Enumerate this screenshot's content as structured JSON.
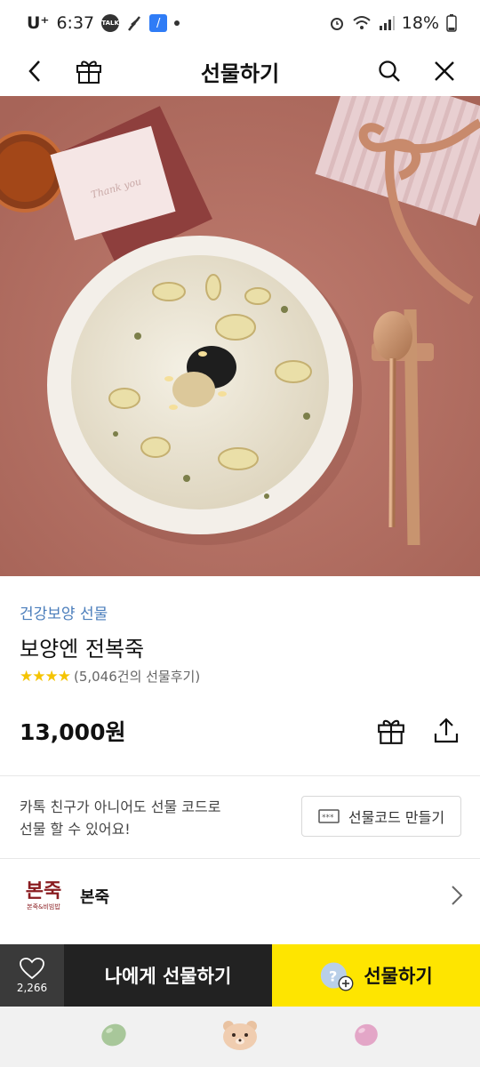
{
  "status_bar": {
    "carrier": "U⁺",
    "time": "6:37",
    "talk_badge": "TALK",
    "battery": "18%"
  },
  "header": {
    "title": "선물하기",
    "back_icon": "chevron-left-icon",
    "gift_icon": "gift-icon",
    "search_icon": "search-icon",
    "close_icon": "close-icon"
  },
  "hero": {
    "card_text": "Thank you",
    "colors": {
      "background": "#b87468",
      "bowl": "#f3efe9",
      "porridge": "#e9e3d3"
    }
  },
  "product": {
    "category": "건강보양 선물",
    "name": "보양엔 전복죽",
    "stars": "★★★★",
    "rating_value": 4,
    "review_text": "(5,046건의 선물후기)",
    "price": "13,000원"
  },
  "gift_code": {
    "description_line1": "카톡 친구가 아니어도 선물 코드로",
    "description_line2": "선물 할 수 있어요!",
    "button_label": "선물코드 만들기"
  },
  "brand": {
    "logo_main": "본죽",
    "logo_sub": "본죽&비빔밥",
    "name": "본죽"
  },
  "action_bar": {
    "like_count": "2,266",
    "self_gift_label": "나에게 선물하기",
    "gift_label": "선물하기",
    "colors": {
      "gift_button": "#fee500",
      "self_gift_button": "#222222"
    }
  },
  "bottom_nav": {
    "items": [
      "green-jelly-icon",
      "bear-icon",
      "pink-jelly-icon"
    ]
  }
}
